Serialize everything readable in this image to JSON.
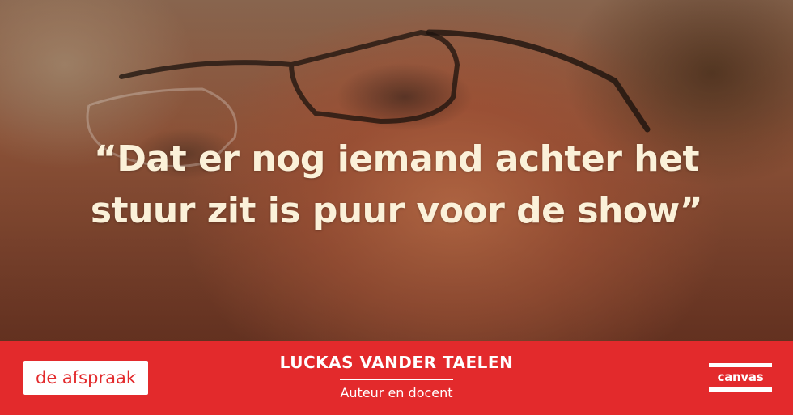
{
  "quote": {
    "line1": "“Dat er nog iemand achter het",
    "line2": "stuur zit is puur voor de show”"
  },
  "speaker": {
    "name": "LUCKAS VANDER TAELEN",
    "role": "Auteur en docent"
  },
  "branding": {
    "program_logo": "de afspraak",
    "channel_logo": "canvas"
  },
  "colors": {
    "band": "#e32a2c",
    "quote_text": "#fbf1d9"
  }
}
